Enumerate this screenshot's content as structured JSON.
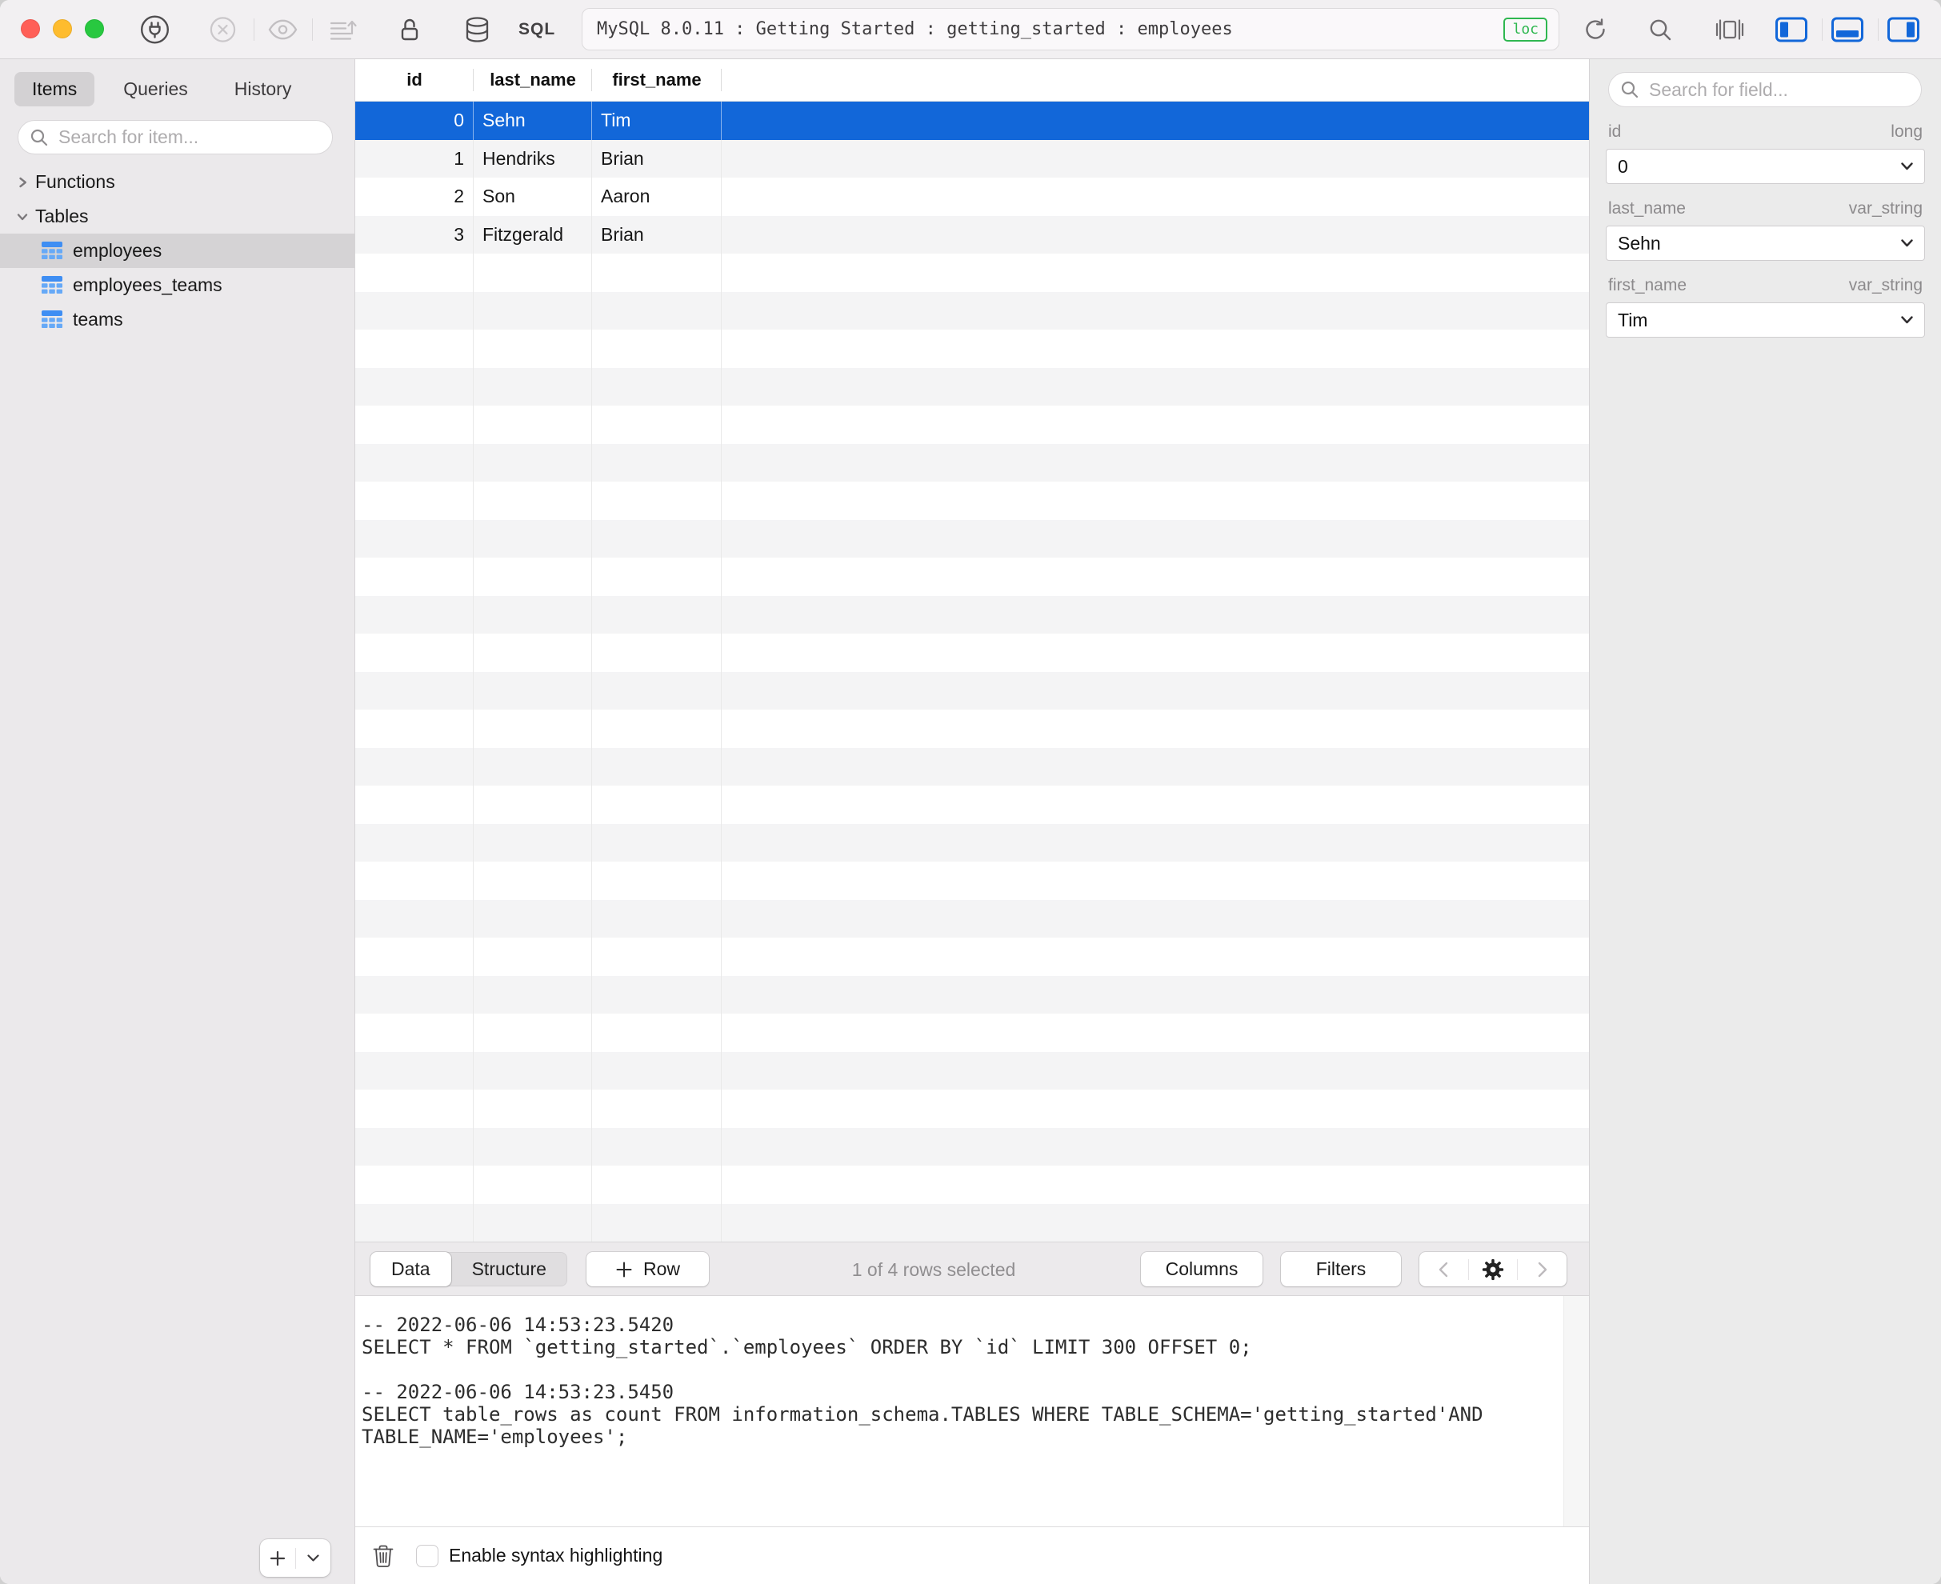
{
  "colors": {
    "accent_blue": "#1267D9",
    "badge_green": "#2FB750",
    "table_icon_blue": "#66A9F7",
    "table_icon_blue_dark": "#3F8EF3",
    "traffic_red": "#FF5F57",
    "traffic_yellow": "#FEBC2E",
    "traffic_green": "#28C840"
  },
  "window": {
    "title": "MySQL 8.0.11 : Getting Started : getting_started : employees",
    "location_badge": "loc"
  },
  "toolbar": {
    "sql_label": "SQL",
    "icons": {
      "connect": "plug-in-circle",
      "disconnect": "x-in-circle",
      "preview": "eye",
      "export_rows": "rows-with-up-arrow",
      "lock": "open-padlock",
      "database": "cylinder",
      "refresh": "circular-arrow",
      "search": "magnifier",
      "viewport": "framed-square",
      "toggle_left_panel": "sidebar-left-filled",
      "toggle_bottom_panel": "panel-bottom-filled",
      "toggle_right_panel": "sidebar-right-filled"
    }
  },
  "sidebar": {
    "tabs": [
      {
        "label": "Items",
        "active": true
      },
      {
        "label": "Queries",
        "active": false
      },
      {
        "label": "History",
        "active": false
      }
    ],
    "search_placeholder": "Search for item...",
    "tree": [
      {
        "label": "Functions",
        "type": "group",
        "expanded": false,
        "selected": false
      },
      {
        "label": "Tables",
        "type": "group",
        "expanded": true,
        "selected": false
      },
      {
        "label": "employees",
        "type": "table",
        "selected": true
      },
      {
        "label": "employees_teams",
        "type": "table",
        "selected": false
      },
      {
        "label": "teams",
        "type": "table",
        "selected": false
      }
    ]
  },
  "table": {
    "columns": [
      "id",
      "last_name",
      "first_name"
    ],
    "rows": [
      [
        "0",
        "Sehn",
        "Tim"
      ],
      [
        "1",
        "Hendriks",
        "Brian"
      ],
      [
        "2",
        "Son",
        "Aaron"
      ],
      [
        "3",
        "Fitzgerald",
        "Brian"
      ]
    ],
    "selected_row_index": 0,
    "empty_row_count": 26
  },
  "bottom_toolbar": {
    "tabs": [
      {
        "label": "Data",
        "active": true
      },
      {
        "label": "Structure",
        "active": false
      }
    ],
    "add_row_label": "Row",
    "selection_status": "1 of 4 rows selected",
    "columns_label": "Columns",
    "filters_label": "Filters",
    "pager_icons": [
      "chevron-left",
      "gear",
      "chevron-right"
    ]
  },
  "sql_log": {
    "lines": [
      "-- 2022-06-06 14:53:23.5420",
      "SELECT * FROM `getting_started`.`employees` ORDER BY `id` LIMIT 300 OFFSET 0;",
      "",
      "-- 2022-06-06 14:53:23.5450",
      "SELECT table_rows as count FROM information_schema.TABLES WHERE TABLE_SCHEMA='getting_started'AND TABLE_NAME='employees';"
    ]
  },
  "status_bar": {
    "trash_icon": "trash-can",
    "syntax_checkbox_label": "Enable syntax highlighting",
    "syntax_checkbox_checked": false
  },
  "right_panel": {
    "search_placeholder": "Search for field...",
    "fields": [
      {
        "name": "id",
        "type": "long",
        "value": "0"
      },
      {
        "name": "last_name",
        "type": "var_string",
        "value": "Sehn"
      },
      {
        "name": "first_name",
        "type": "var_string",
        "value": "Tim"
      }
    ]
  }
}
